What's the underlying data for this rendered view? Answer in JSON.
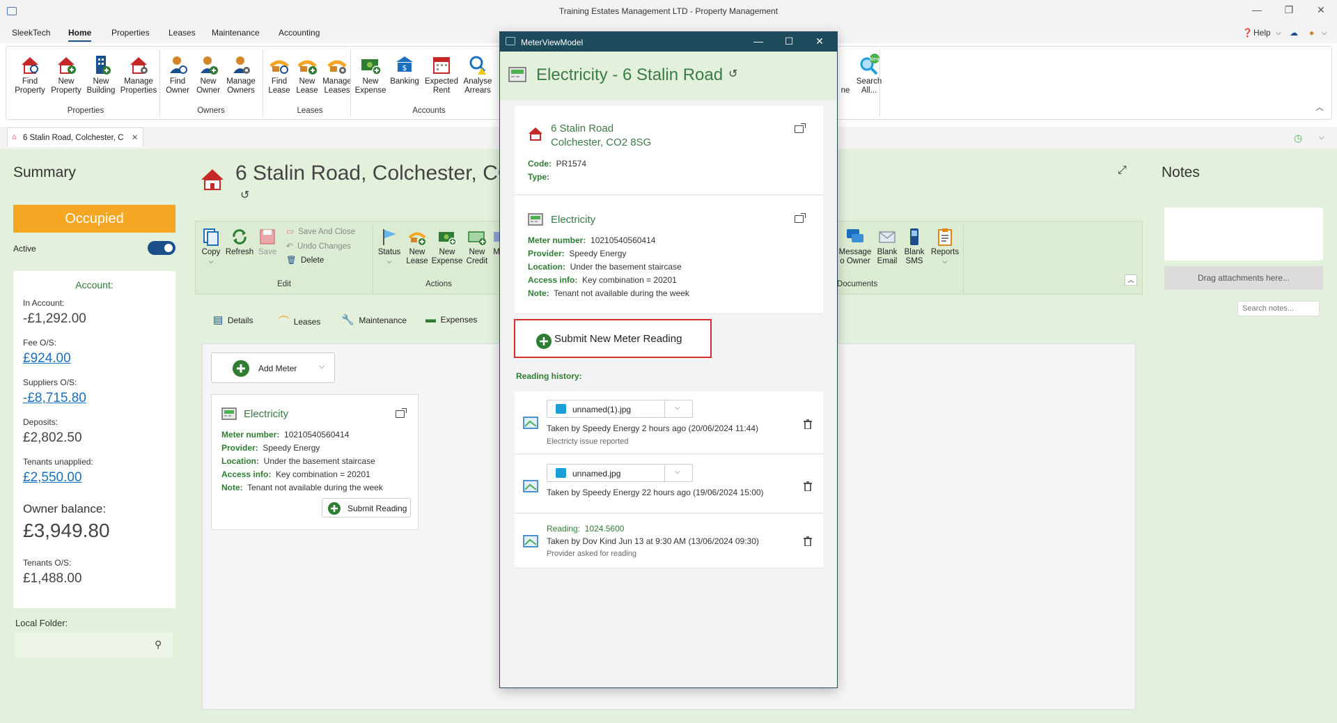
{
  "window": {
    "title": "Training Estates Management LTD - Property Management"
  },
  "menu": {
    "items": [
      "SleekTech",
      "Home",
      "Properties",
      "Leases",
      "Maintenance",
      "Accounting"
    ],
    "active": "Home",
    "help": "Help"
  },
  "ribbon": {
    "buttons": [
      {
        "l1": "Find",
        "l2": "Property"
      },
      {
        "l1": "New",
        "l2": "Property"
      },
      {
        "l1": "New",
        "l2": "Building"
      },
      {
        "l1": "Manage",
        "l2": "Properties"
      },
      {
        "l1": "Find",
        "l2": "Owner"
      },
      {
        "l1": "New",
        "l2": "Owner"
      },
      {
        "l1": "Manage",
        "l2": "Owners"
      },
      {
        "l1": "Find",
        "l2": "Lease"
      },
      {
        "l1": "New",
        "l2": "Lease"
      },
      {
        "l1": "Manage",
        "l2": "Leases"
      },
      {
        "l1": "New",
        "l2": "Expense"
      },
      {
        "l1": "Banking",
        "l2": ""
      },
      {
        "l1": "Expected",
        "l2": "Rent"
      },
      {
        "l1": "Analyse",
        "l2": "Arrears"
      }
    ],
    "groups": [
      "Properties",
      "Owners",
      "Leases",
      "Accounts"
    ],
    "right_partial": "ne",
    "search_all": {
      "l1": "Search",
      "l2": "All...",
      "badge": "New"
    }
  },
  "doc_tab": {
    "label": "6 Stalin Road, Colchester, C"
  },
  "summary": {
    "title": "Summary",
    "status": "Occupied",
    "active_label": "Active",
    "account": {
      "heading": "Account:",
      "in_account_label": "In Account:",
      "in_account": "-£1,292.00",
      "fee_label": "Fee O/S:",
      "fee": "£924.00",
      "suppliers_label": "Suppliers O/S:",
      "suppliers": "-£8,715.80",
      "deposits_label": "Deposits:",
      "deposits": "£2,802.50",
      "tenants_unapplied_label": "Tenants unapplied:",
      "tenants_unapplied": "£2,550.00",
      "owner_balance_label": "Owner balance:",
      "owner_balance": "£3,949.80",
      "tenants_os_label": "Tenants O/S:",
      "tenants_os": "£1,488.00"
    },
    "local_folder_label": "Local Folder:"
  },
  "property": {
    "title": "6 Stalin Road, Colchester, CO2",
    "ribbon": {
      "copy": "Copy",
      "refresh": "Refresh",
      "save": "Save",
      "save_close": "Save And Close",
      "undo": "Undo Changes",
      "delete": "Delete",
      "status": "Status",
      "new_lease": {
        "l1": "New",
        "l2": "Lease"
      },
      "new_expense": {
        "l1": "New",
        "l2": "Expense"
      },
      "new_credit": {
        "l1": "New",
        "l2": "Credit"
      },
      "partial": "M",
      "message_owner": {
        "l1": "Message",
        "l2": "o Owner"
      },
      "blank_email": {
        "l1": "Blank",
        "l2": "Email"
      },
      "blank_sms": {
        "l1": "Blank",
        "l2": "SMS"
      },
      "reports": "Reports",
      "groups": {
        "edit": "Edit",
        "actions": "Actions",
        "documents": "Documents"
      }
    },
    "tabs": [
      "Details",
      "Leases",
      "Maintenance",
      "Expenses"
    ],
    "add_meter": "Add Meter",
    "meter_card": {
      "title": "Electricity",
      "meter_number_label": "Meter number:",
      "meter_number": "10210540560414",
      "provider_label": "Provider:",
      "provider": "Speedy Energy",
      "location_label": "Location:",
      "location": "Under the basement staircase",
      "access_label": "Access info:",
      "access": "Key combination = 20201",
      "note_label": "Note:",
      "note": "Tenant not available during the week",
      "submit": "Submit Reading"
    }
  },
  "notes": {
    "title": "Notes",
    "drop": "Drag attachments here...",
    "search_placeholder": "Search notes..."
  },
  "dialog": {
    "window_title": "MeterViewModel",
    "heading": "Electricity - 6 Stalin Road",
    "address": {
      "line1": "6 Stalin Road",
      "line2": "Colchester, CO2 8SG",
      "code_label": "Code:",
      "code": "PR1574",
      "type_label": "Type:"
    },
    "meter": {
      "title": "Electricity",
      "meter_number_label": "Meter number:",
      "meter_number": "10210540560414",
      "provider_label": "Provider:",
      "provider": "Speedy Energy",
      "location_label": "Location:",
      "location": "Under the basement staircase",
      "access_label": "Access info:",
      "access": "Key combination = 20201",
      "note_label": "Note:",
      "note": "Tenant not available during the week"
    },
    "submit_new": "Submit New Meter Reading",
    "history_label": "Reading history:",
    "history": [
      {
        "file": "unnamed(1).jpg",
        "taken": "Taken by Speedy Energy  2 hours ago (20/06/2024 11:44)",
        "note": "Electricty issue reported"
      },
      {
        "file": "unnamed.jpg",
        "taken": "Taken by Speedy Energy  22 hours ago (19/06/2024 15:00)",
        "note": ""
      },
      {
        "reading_label": "Reading:",
        "reading": "1024.5600",
        "taken": "Taken by Dov Kind Jun 13 at 9:30 AM (13/06/2024 09:30)",
        "note": "Provider asked for reading"
      }
    ]
  },
  "colors": {
    "accent": "#1a4f8b",
    "green": "#2e7d32",
    "occupied": "#f5a623",
    "panel": "#e2f0dc",
    "highlight": "#d32f2f"
  }
}
